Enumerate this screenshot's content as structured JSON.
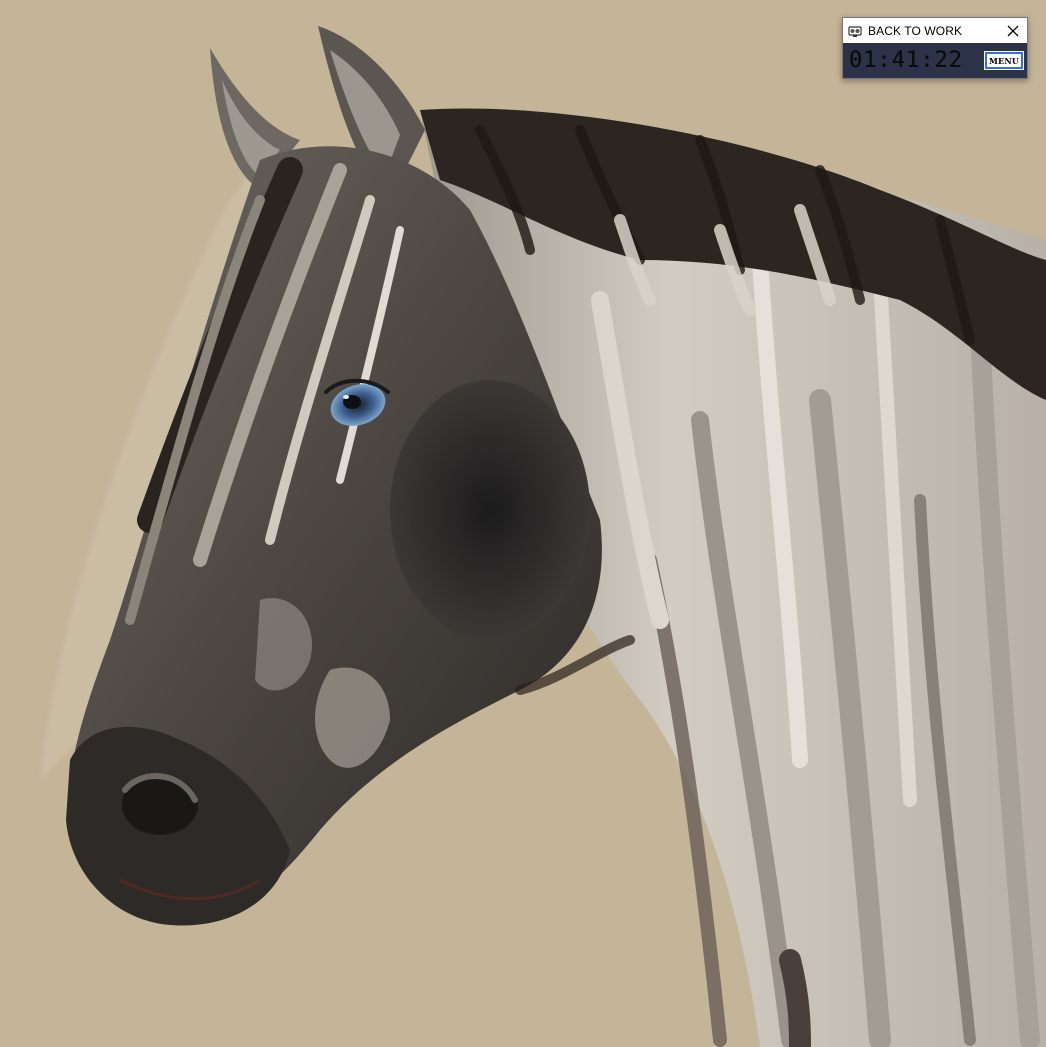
{
  "artwork": {
    "background_color": "#c4b498"
  },
  "timer_window": {
    "title": "BACK TO WORK",
    "icon": "timer-app-icon",
    "close_icon": "close-icon",
    "time": "01:41:22",
    "menu_label": "MENU",
    "colors": {
      "display_bg": "#2c3247",
      "menu_border": "#3a6fd8"
    }
  }
}
